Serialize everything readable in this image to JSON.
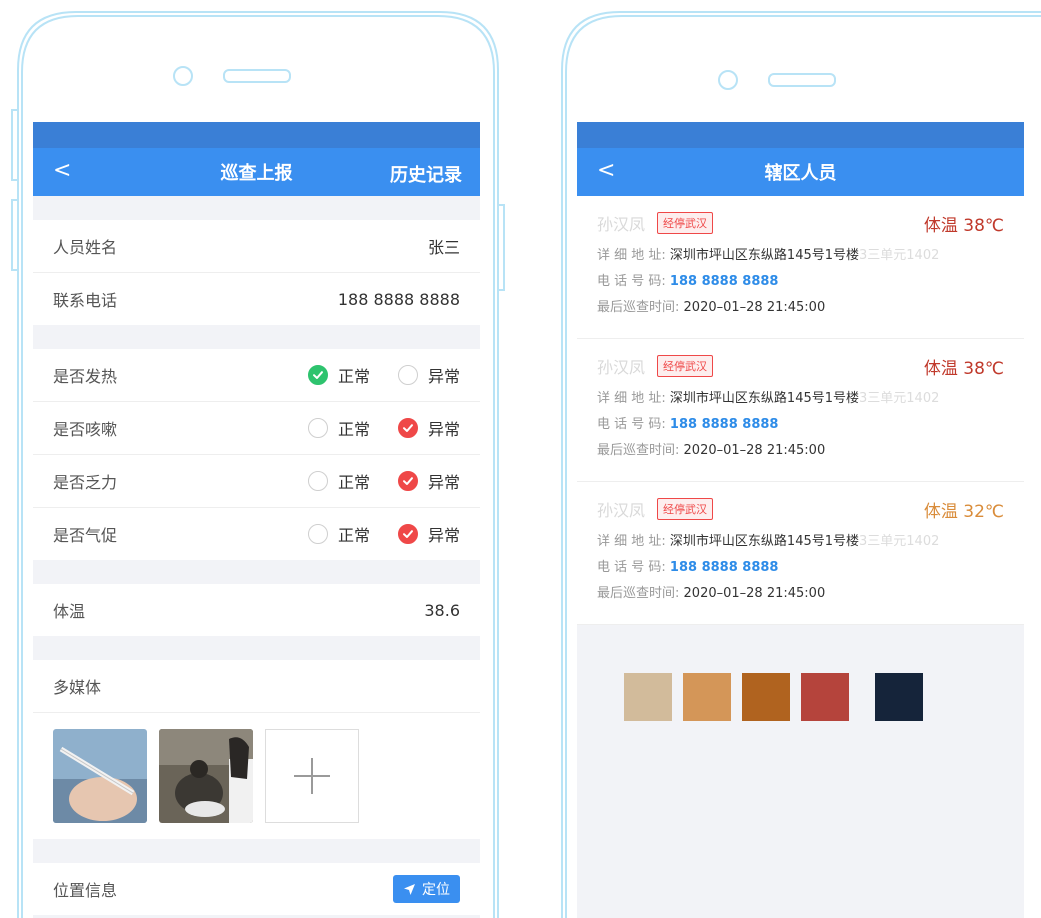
{
  "left": {
    "nav": {
      "back": "<",
      "title": "巡查上报",
      "history": "历史记录"
    },
    "person": {
      "name_label": "人员姓名",
      "name_value": "张三",
      "phone_label": "联系电话",
      "phone_value": "188 8888 8888"
    },
    "options": {
      "normal": "正常",
      "abnormal": "异常"
    },
    "symptoms": [
      {
        "label": "是否发热",
        "selected": "normal"
      },
      {
        "label": "是否咳嗽",
        "selected": "abnormal"
      },
      {
        "label": "是否乏力",
        "selected": "abnormal"
      },
      {
        "label": "是否气促",
        "selected": "abnormal"
      }
    ],
    "temperature": {
      "label": "体温",
      "value": "38.6"
    },
    "media": {
      "label": "多媒体"
    },
    "location": {
      "label": "位置信息",
      "button": "定位"
    }
  },
  "right": {
    "nav": {
      "back": "<",
      "title": "辖区人员"
    },
    "field_labels": {
      "address": "详 细 地 址:",
      "phone": "电 话 号 码:",
      "last": "最后巡查时间:"
    },
    "people": [
      {
        "name": "孙汉凤",
        "tag": "经停武汉",
        "temp": "体温 38℃",
        "level": "high",
        "address": "深圳市坪山区东纵路145号1号楼",
        "address_faded": "3三单元1402",
        "phone": "188 8888 8888",
        "last": "2020–01–28 21:45:00"
      },
      {
        "name": "孙汉凤",
        "tag": "经停武汉",
        "temp": "体温 38℃",
        "level": "high",
        "address": "深圳市坪山区东纵路145号1号楼",
        "address_faded": "3三单元1402",
        "phone": "188 8888 8888",
        "last": "2020–01–28 21:45:00"
      },
      {
        "name": "孙汉凤",
        "tag": "经停武汉",
        "temp": "体温 32℃",
        "level": "mid",
        "address": "深圳市坪山区东纵路145号1号楼",
        "address_faded": "3三单元1402",
        "phone": "188 8888 8888",
        "last": "2020–01–28 21:45:00"
      }
    ],
    "palette": [
      "#d2bb9b",
      "#d49658",
      "#b0631f",
      "#b5443c",
      "#15243a"
    ]
  },
  "colors": {
    "primary": "#3a8ff0",
    "status_bar": "#3a7fd6",
    "ok": "#2ec36e",
    "alert": "#ef4848",
    "outline": "#b8e3f6"
  }
}
